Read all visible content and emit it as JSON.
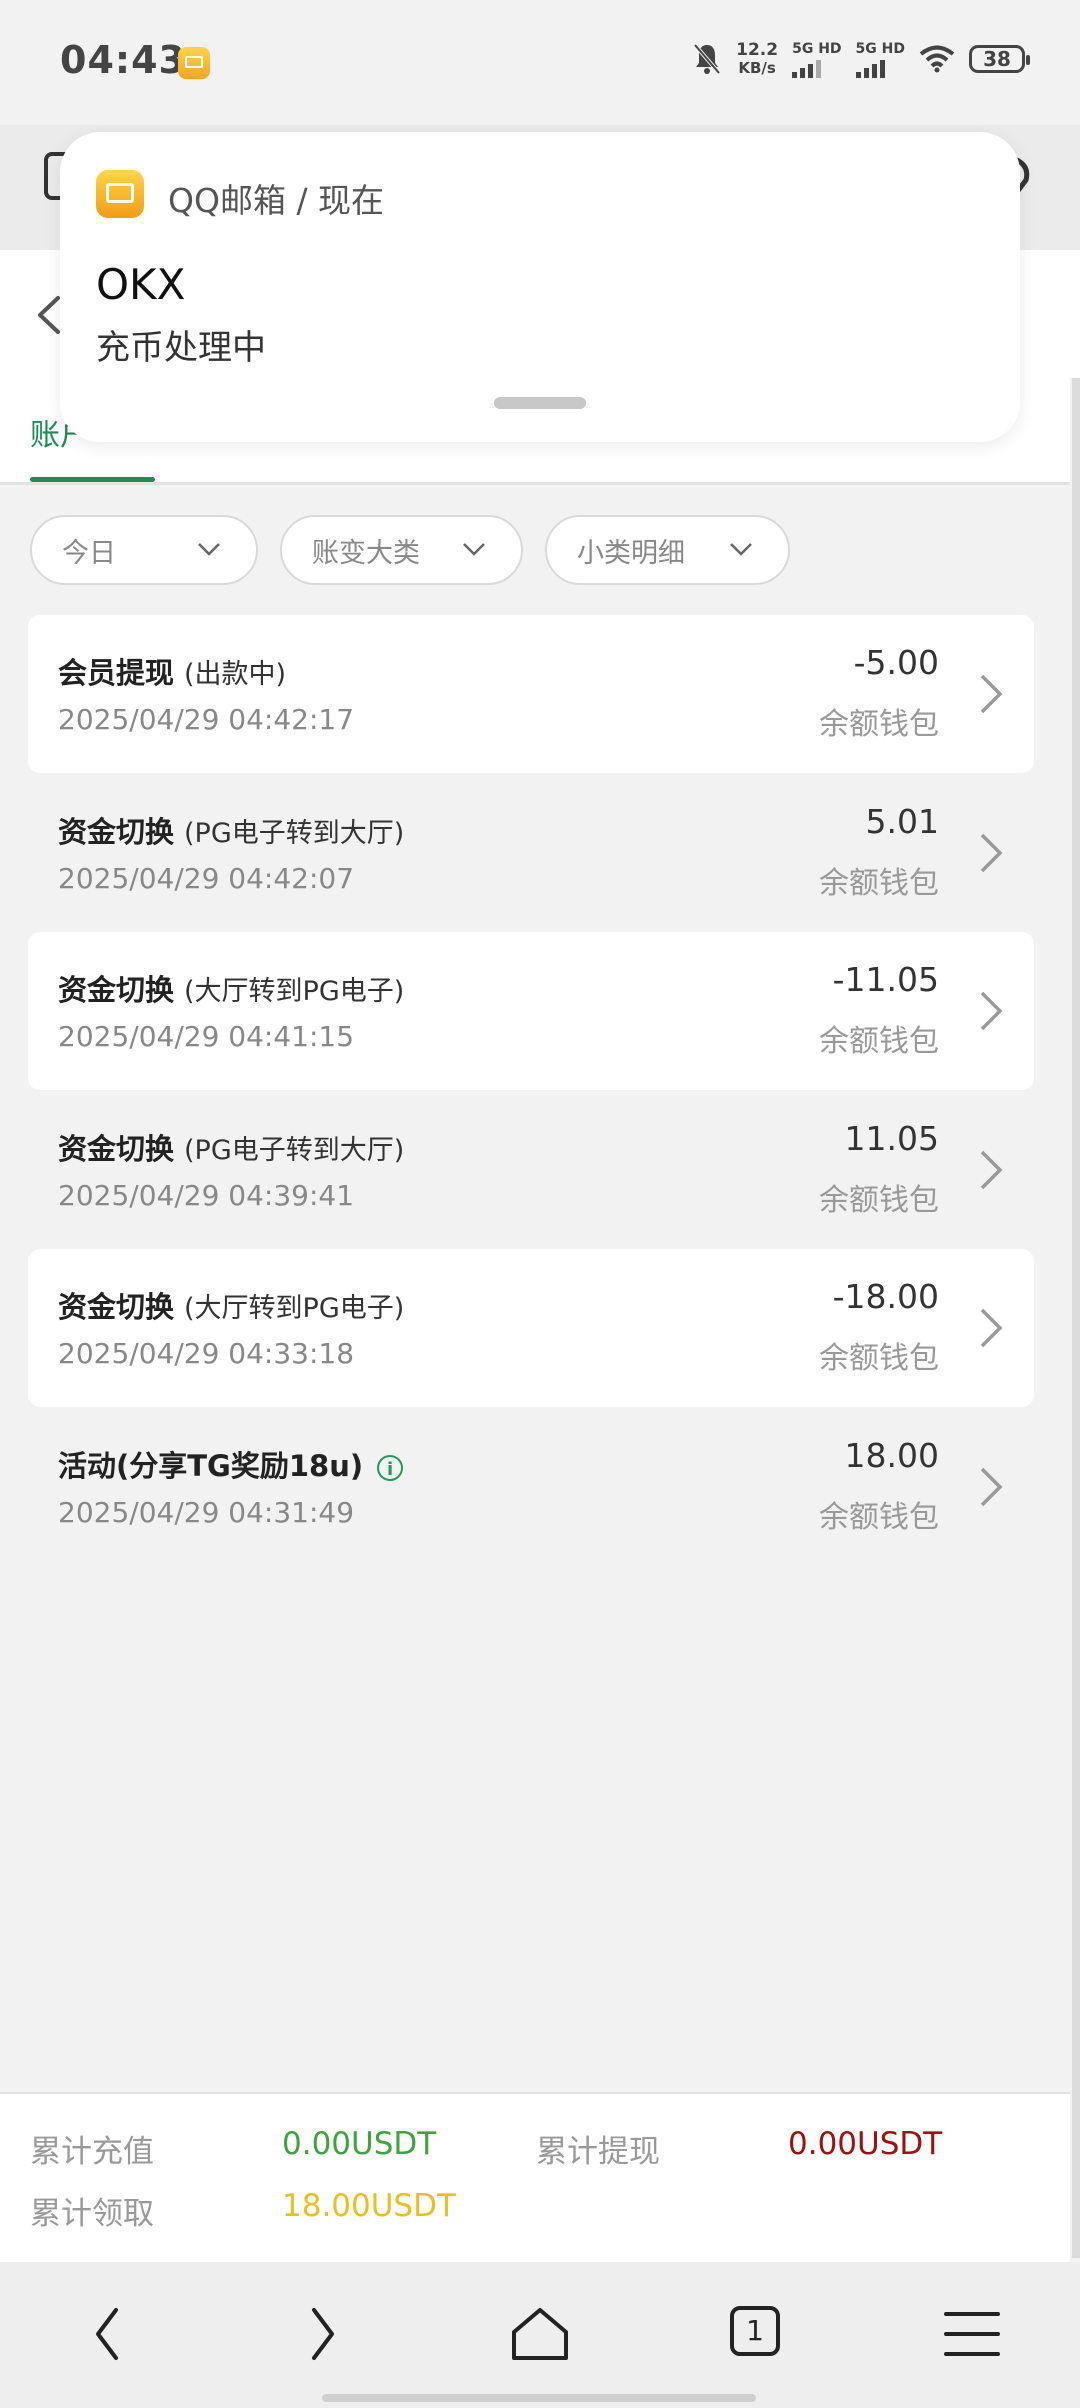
{
  "status_bar": {
    "time": "04:43",
    "net_speed_value": "12.2",
    "net_speed_unit": "KB/s",
    "sim1": "5G HD",
    "sim2": "5G HD",
    "battery": "38"
  },
  "notification": {
    "app": "QQ邮箱 / 现在",
    "title": "OKX",
    "body": "充币处理中"
  },
  "tabs": {
    "active_label": "账户"
  },
  "filters": [
    {
      "label": "今日"
    },
    {
      "label": "账变大类"
    },
    {
      "label": "小类明细"
    }
  ],
  "records": [
    {
      "title": "会员提现",
      "sub": "(出款中)",
      "date": "2025/04/29 04:42:17",
      "amount": "-5.00",
      "wallet": "余额钱包"
    },
    {
      "title": "资金切换",
      "sub": "(PG电子转到大厅)",
      "date": "2025/04/29 04:42:07",
      "amount": "5.01",
      "wallet": "余额钱包"
    },
    {
      "title": "资金切换",
      "sub": "(大厅转到PG电子)",
      "date": "2025/04/29 04:41:15",
      "amount": "-11.05",
      "wallet": "余额钱包"
    },
    {
      "title": "资金切换",
      "sub": "(PG电子转到大厅)",
      "date": "2025/04/29 04:39:41",
      "amount": "11.05",
      "wallet": "余额钱包"
    },
    {
      "title": "资金切换",
      "sub": "(大厅转到PG电子)",
      "date": "2025/04/29 04:33:18",
      "amount": "-18.00",
      "wallet": "余额钱包"
    },
    {
      "title": "活动(分享TG奖励18u)",
      "sub": "",
      "date": "2025/04/29 04:31:49",
      "amount": "18.00",
      "wallet": "余额钱包"
    }
  ],
  "summary": {
    "deposit_label": "累计充值",
    "deposit_value": "0.00USDT",
    "withdraw_label": "累计提现",
    "withdraw_value": "0.00USDT",
    "claim_label": "累计领取",
    "claim_value": "18.00USDT"
  },
  "nav": {
    "tab_count": "1"
  },
  "colors": {
    "accent_green": "#1f8c55",
    "deposit_green": "#3fa33f",
    "withdraw_red": "#a01010",
    "claim_yellow": "#e8c020"
  }
}
